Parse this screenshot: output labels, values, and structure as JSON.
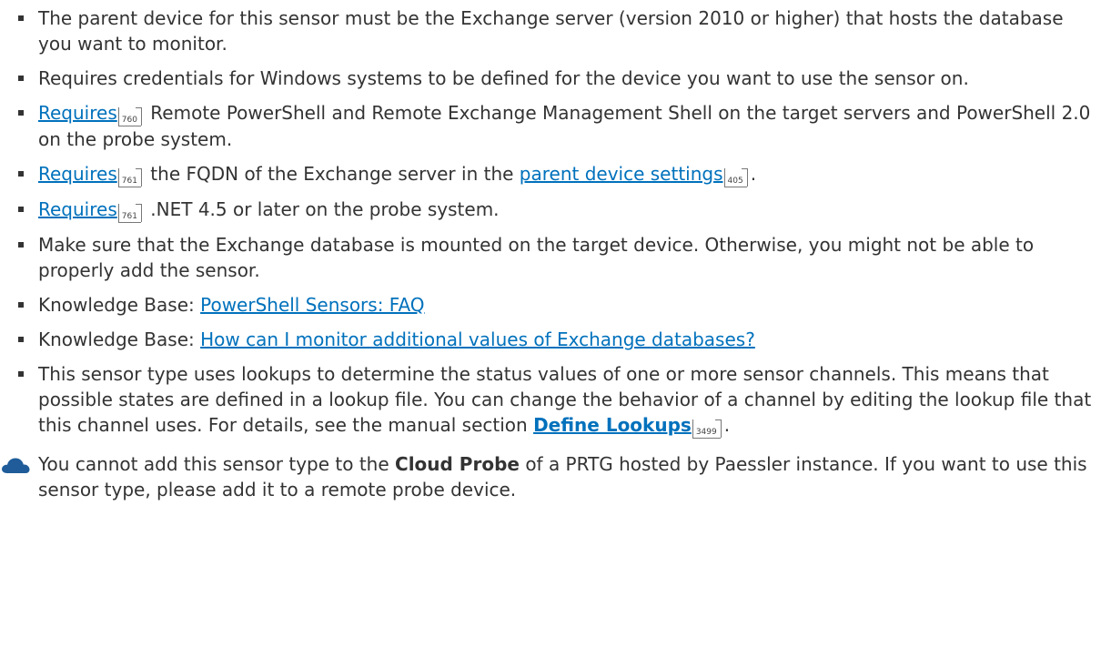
{
  "bullets": [
    {
      "text": "The parent device for this sensor must be the Exchange server (version 2010 or higher) that hosts the database you want to monitor."
    },
    {
      "text": "Requires credentials for Windows systems to be defined for the device you want to use the sensor on."
    },
    {
      "link": "Requires",
      "page": "760",
      "text": "Remote PowerShell and Remote Exchange Management Shell on the target servers and PowerShell 2.0 on the probe system."
    },
    {
      "link": "Requires",
      "page": "761",
      "text_before": "the FQDN of the Exchange server in the",
      "link2": "parent device settings",
      "page2": "405",
      "text_after": "."
    },
    {
      "link": "Requires",
      "page": "761",
      "text": ".NET 4.5 or later on the probe system."
    },
    {
      "text": "Make sure that the Exchange database is mounted on the target device. Otherwise, you might not be able to properly add the sensor."
    },
    {
      "prefix": "Knowledge Base:",
      "link": "PowerShell Sensors: FAQ"
    },
    {
      "prefix": "Knowledge Base:",
      "link": "How can I monitor additional values of Exchange databases?"
    },
    {
      "text": "This sensor type uses lookups to determine the status values of one or more sensor channels. This means that possible states are defined in a lookup file. You can change the behavior of a channel by editing the lookup file that this channel uses. For details, see the manual section",
      "link": "Define Lookups",
      "page": "3499",
      "text_after": "."
    }
  ],
  "note": {
    "icon": "cloud-icon",
    "text_before": "You cannot add this sensor type to the",
    "bold": "Cloud Probe",
    "text_after": "of a PRTG hosted by Paessler instance. If you want to use this sensor type, please add it to a remote probe device."
  },
  "colors": {
    "link": "#0071bc",
    "text": "#333333",
    "cloud": "#1f5c99"
  }
}
